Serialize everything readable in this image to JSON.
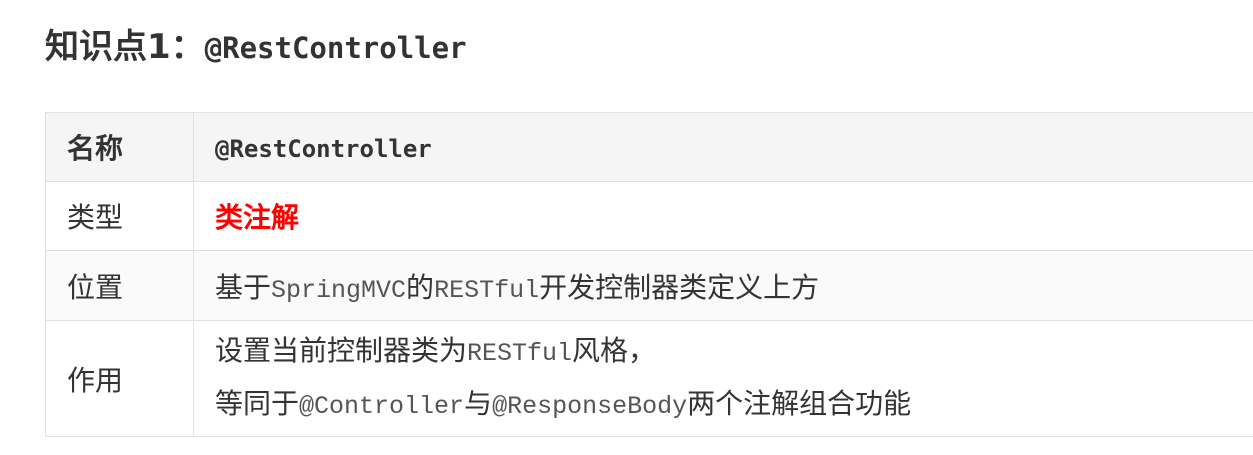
{
  "heading": {
    "prefix": "知识点1：",
    "code": "@RestController"
  },
  "table": {
    "header": {
      "key": "名称",
      "value": "@RestController"
    },
    "type": {
      "key": "类型",
      "value": "类注解",
      "value_color": "#ff0000"
    },
    "position": {
      "key": "位置",
      "part1": "基于",
      "code1": "SpringMVC",
      "part2": "的",
      "code2": "RESTful",
      "part3": "开发控制器类定义上方"
    },
    "usage": {
      "key": "作用",
      "line1_part1": "设置当前控制器类为",
      "line1_code": "RESTful",
      "line1_part2": "风格，",
      "line2_part1": "等同于",
      "line2_code1": "@Controller",
      "line2_part2": "与",
      "line2_code2": "@ResponseBody",
      "line2_part3": "两个注解组合功能"
    }
  }
}
